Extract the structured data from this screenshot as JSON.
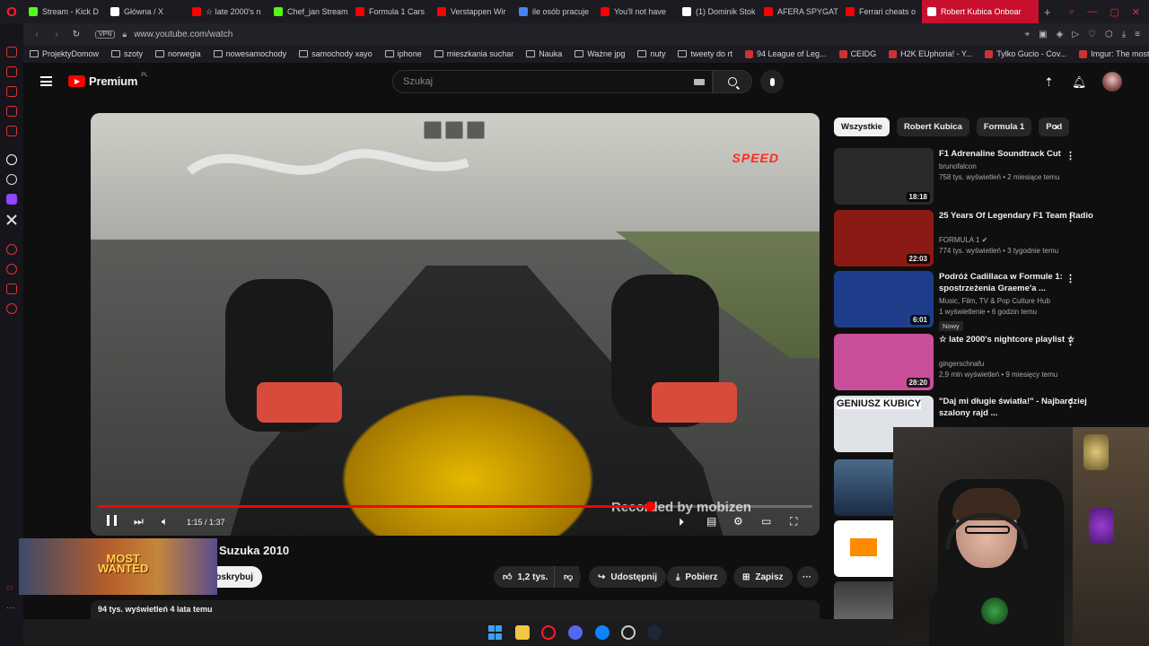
{
  "browser": {
    "tabs": [
      {
        "label": "Stream - Kick D",
        "color": "#53fc18"
      },
      {
        "label": "Główna / X",
        "color": "#ffffff"
      },
      {
        "label": "☆ late 2000's n",
        "color": "#ff0000"
      },
      {
        "label": "Chef_jan Stream",
        "color": "#53fc18"
      },
      {
        "label": "Formula 1 Cars",
        "color": "#ff0000"
      },
      {
        "label": "Verstappen Wir",
        "color": "#ff0000"
      },
      {
        "label": "ile osób pracuje",
        "color": "#4285f4"
      },
      {
        "label": "You'll not have",
        "color": "#ff0000"
      },
      {
        "label": "(1) Dominik Stok",
        "color": "#ffffff"
      },
      {
        "label": "AFERA SPYGAT",
        "color": "#ff0000"
      },
      {
        "label": "Ferrari cheats o",
        "color": "#ff0000"
      },
      {
        "label": "Robert Kubica Onboar",
        "color": "#ff0000",
        "active": true
      }
    ],
    "new_tab": "+",
    "url": "www.youtube.com/watch",
    "vpn": "VPN",
    "bookmarks": [
      {
        "label": "ProjektyDomow",
        "type": "folder"
      },
      {
        "label": "szoty",
        "type": "folder"
      },
      {
        "label": "norwegia",
        "type": "folder"
      },
      {
        "label": "nowesamochody",
        "type": "folder"
      },
      {
        "label": "samochody xayo",
        "type": "folder"
      },
      {
        "label": "iphone",
        "type": "folder"
      },
      {
        "label": "mieszkania suchar",
        "type": "folder"
      },
      {
        "label": "Nauka",
        "type": "folder"
      },
      {
        "label": "Ważne jpg",
        "type": "folder"
      },
      {
        "label": "nuty",
        "type": "folder"
      },
      {
        "label": "tweety do rt",
        "type": "folder"
      },
      {
        "label": "94 League of Leg...",
        "type": "site"
      },
      {
        "label": "CEIDG",
        "type": "site"
      },
      {
        "label": "H2K EUphoria! - Y...",
        "type": "site"
      },
      {
        "label": "Tylko Gucio - Cov...",
        "type": "site"
      },
      {
        "label": "Imgur: The most a...",
        "type": "site"
      }
    ]
  },
  "youtube": {
    "logo_text": "Premium",
    "logo_region": "PL",
    "search_placeholder": "Szukaj",
    "player": {
      "overlay_logo": "SPEED",
      "watermark": "Recorded by mobizen",
      "time": "1:15 / 1:37",
      "progress": 0.773
    },
    "video": {
      "title": "Suzuka 2010",
      "subscribe": "Subskrybuj",
      "likes": "1,2 tys.",
      "share": "Udostępnij",
      "download": "Pobierz",
      "save": "Zapisz",
      "stats": "94 tys. wyświetleń  4 lata temu"
    },
    "ad": {
      "text_line1": "MOST",
      "text_line2": "WANTED"
    },
    "chips": [
      "Wszystkie",
      "Robert Kubica",
      "Formula 1",
      "Pod"
    ],
    "recommendations": [
      {
        "title": "F1 Adrenaline Soundtrack Cut",
        "channel": "brunofalcon",
        "meta": "758 tys. wyświetleń • 2 miesiące temu",
        "duration": "18:18",
        "thumb": "#2a2a2a"
      },
      {
        "title": "25 Years Of Legendary F1 Team Radio",
        "channel": "FORMULA 1",
        "meta": "774 tys. wyświetleń • 3 tygodnie temu",
        "duration": "22:03",
        "thumb": "#8b1a14",
        "verified": "✔"
      },
      {
        "title": "Podróż Cadillaca w Formule 1: spostrzeżenia Graeme'a ...",
        "channel": "Music, Film, TV & Pop Culture Hub",
        "meta": "1 wyświetlenie • 6 godzin temu",
        "duration": "6:01",
        "thumb": "#1f3d8a",
        "badge": "Nowy"
      },
      {
        "title": "☆ late 2000's nightcore playlist ☆",
        "channel": "gingerschnafu",
        "meta": "2,9 mln wyświetleń • 9 miesięcy temu",
        "duration": "28:20",
        "thumb": "#c94f9a"
      },
      {
        "title": "\"Daj mi długie światła!\" - Najbardziej szalony rajd ...",
        "channel": "",
        "meta": "",
        "duration": "",
        "thumb": "#dfe3e8",
        "overlay": "GENIUSZ KUBICY"
      }
    ]
  }
}
